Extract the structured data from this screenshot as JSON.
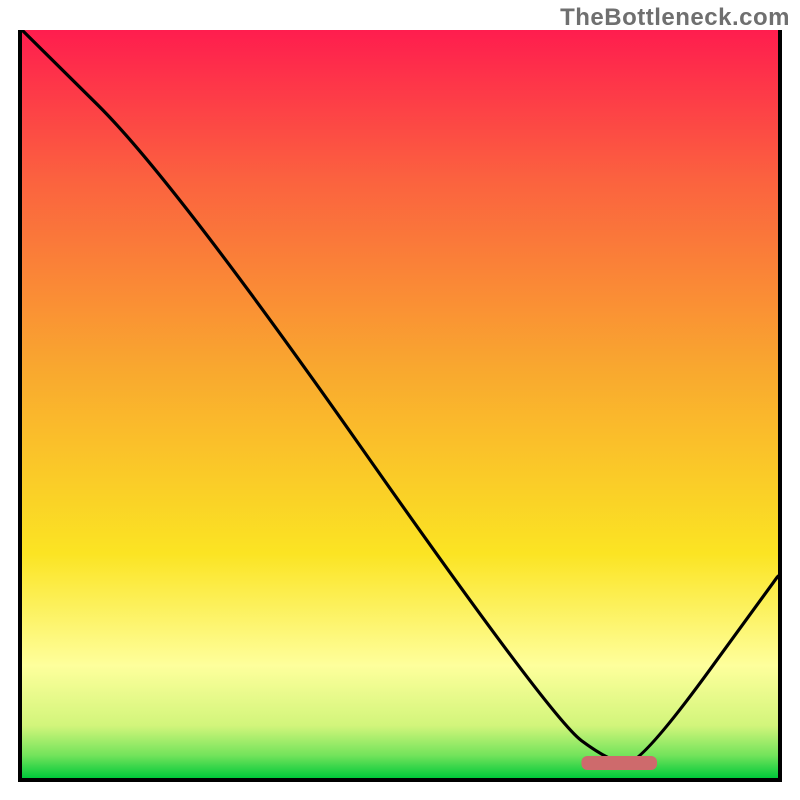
{
  "watermark": "TheBottleneck.com",
  "chart_data": {
    "type": "line",
    "title": "",
    "xlabel": "",
    "ylabel": "",
    "xlim": [
      0,
      100
    ],
    "ylim": [
      0,
      100
    ],
    "grid": false,
    "legend": false,
    "background": "gradient red→orange→yellow→pale-yellow→green (top→bottom)",
    "series": [
      {
        "name": "bottleneck-curve",
        "x": [
          0,
          20,
          70,
          78,
          82,
          100
        ],
        "y": [
          100,
          80,
          8,
          2,
          2,
          27
        ]
      }
    ],
    "marker": {
      "name": "sweet-spot",
      "x_range": [
        74,
        84
      ],
      "y": 2,
      "color": "#ce6a6c"
    },
    "gradient_stops": [
      {
        "pct": 0,
        "color": "#ff1d4e"
      },
      {
        "pct": 20,
        "color": "#fb623f"
      },
      {
        "pct": 45,
        "color": "#f9a72f"
      },
      {
        "pct": 70,
        "color": "#fbe423"
      },
      {
        "pct": 85,
        "color": "#feff9c"
      },
      {
        "pct": 93,
        "color": "#d2f57b"
      },
      {
        "pct": 97,
        "color": "#72e35b"
      },
      {
        "pct": 100,
        "color": "#00c93a"
      }
    ]
  }
}
